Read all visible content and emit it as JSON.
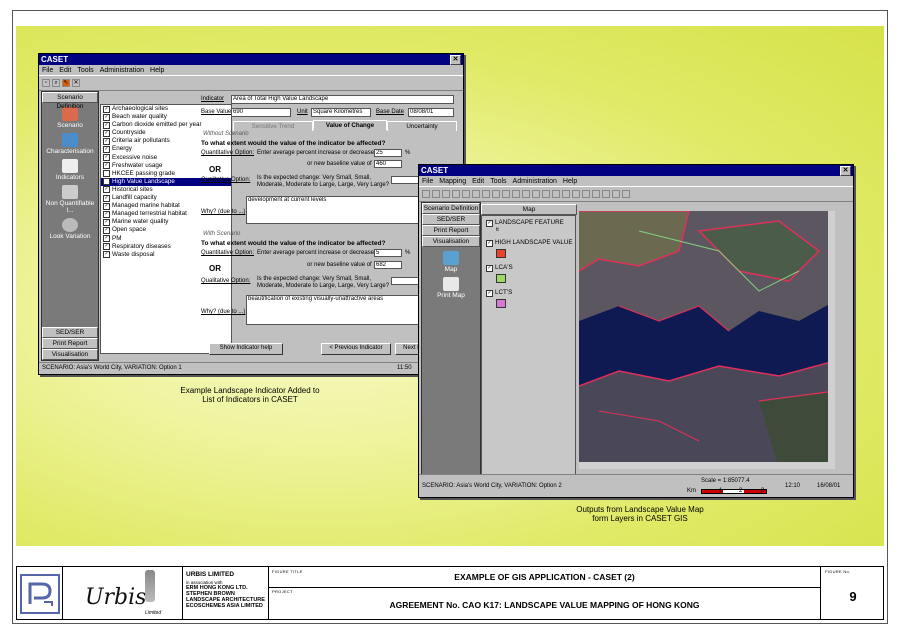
{
  "win1": {
    "title": "CASET",
    "close": "✕",
    "menu": [
      "File",
      "Edit",
      "Tools",
      "Administration",
      "Help"
    ],
    "nav_top": "Scenario Definition",
    "nav_items": [
      "Scenario",
      "Characterisation",
      "Indicators",
      "Non Quantifiable I...",
      "Look Variation"
    ],
    "nav_bottom": [
      "SED/SER",
      "Print Report",
      "Visualisation"
    ],
    "list_items": [
      {
        "label": "Archaeological sites",
        "checked": true
      },
      {
        "label": "Beach water quality",
        "checked": true
      },
      {
        "label": "Carbon dioxide emitted per year",
        "checked": true
      },
      {
        "label": "Countryside",
        "checked": true
      },
      {
        "label": "Criteria air pollutants",
        "checked": true
      },
      {
        "label": "Energy",
        "checked": true
      },
      {
        "label": "Excessive noise",
        "checked": true
      },
      {
        "label": "Freshwater usage",
        "checked": true
      },
      {
        "label": "HKCEE passing grade",
        "checked": false
      },
      {
        "label": "High Value Landscape",
        "checked": false,
        "selected": true
      },
      {
        "label": "Historical sites",
        "checked": true
      },
      {
        "label": "Landfill capacity",
        "checked": true
      },
      {
        "label": "Managed marine habitat",
        "checked": true
      },
      {
        "label": "Managed terrestrial habitat",
        "checked": true
      },
      {
        "label": "Marine water quality",
        "checked": true
      },
      {
        "label": "Open space",
        "checked": true
      },
      {
        "label": "PM",
        "checked": true
      },
      {
        "label": "Respiratory diseases",
        "checked": true
      },
      {
        "label": "Waste disposal",
        "checked": true
      }
    ],
    "indicator_label": "Indicator",
    "indicator_value": "Area of Total High Value Landscape",
    "base_value_label": "Base Value",
    "base_value": "690",
    "unit_label": "Unit",
    "unit_value": "Square Kilometres",
    "base_date_label": "Base Date",
    "base_date": "08/08/01",
    "tabs": [
      "Sensitive Trend",
      "Value of Change",
      "Uncertainty"
    ],
    "without_scenario": "Without Scenario",
    "q1": "To what extent would the value of the indicator be affected?",
    "quant_label": "Quantitative Option:",
    "quant_text": "Enter average percent increase or decrease",
    "quant1_value": "25",
    "pct": "%",
    "or_new": "or new baseline value of",
    "baseline1_value": "460",
    "or": "OR",
    "qual_label": "Qualitative Option:",
    "qual_text": "Is the expected change: Very Small, Small, Moderate, Moderate to Large, Large, Very Large?",
    "why_label": "Why? (due to ...)",
    "why1": "development at current levels",
    "with_scenario": "With Scenario",
    "q2": "To what extent would the value of the indicator be affected?",
    "quant2_value": "5",
    "baseline2_value": "682",
    "why2": "beautification of existing visually-unattractive areas",
    "btn_help": "Show Indicator help",
    "btn_prev": "< Previous Indicator",
    "btn_next": "Next I",
    "status": "SCENARIO: Asia's World City, VARIATION: Option 1",
    "status_time": "11:50"
  },
  "caption1": [
    "Example Landscape Indicator Added to",
    "List of Indicators in CASET"
  ],
  "win2": {
    "title": "CASET",
    "close": "✕",
    "menu": [
      "File",
      "Mapping",
      "Edit",
      "Tools",
      "Administration",
      "Help"
    ],
    "nav_top": "Scenario Definition",
    "nav_tabs": [
      "SED/SER",
      "Print Report",
      "Visualisation"
    ],
    "nav_items": [
      "Map",
      "Print Map"
    ],
    "layers_header": "Map",
    "layers": [
      {
        "label": "LANDSCAPE FEATURE",
        "sub": "tt",
        "color": ""
      },
      {
        "label": "HIGH LANDSCAPE VALUE",
        "sub": "",
        "color": "#e8442c"
      },
      {
        "label": "LCA'S",
        "sub": "",
        "color": "#9fd86a"
      },
      {
        "label": "LCT'S",
        "sub": "",
        "color": "#d57ad0"
      }
    ],
    "status": "SCENARIO: Asia's World City, VARIATION: Option 2",
    "scale": "Scale = 1:85077.4",
    "scale_km": "Km",
    "scale_ticks": [
      "1",
      "2",
      "3"
    ],
    "time": "12:10",
    "date": "16/08/01"
  },
  "caption2": [
    "Outputs from Landscape Value Map",
    "form Layers in CASET GIS"
  ],
  "titleblock": {
    "company": "URBIS LIMITED",
    "assoc": "in association with",
    "partners": [
      "ERM HONG KONG LTD.",
      "STEPHEN BROWN",
      "LANDSCAPE ARCHITECTURE",
      "ECOSCHEMES ASIA LIMITED"
    ],
    "logo_text": "Urbis",
    "logo_sub": "Limited",
    "figure_title_label": "FIGURE TITLE",
    "figure_title": "EXAMPLE OF GIS APPLICATION - CASET (2)",
    "project_label": "PROJECT",
    "project": "AGREEMENT No. CAO K17:  LANDSCAPE VALUE MAPPING OF HONG KONG",
    "figure_no_label": "FIGURE No.",
    "figure_no": "9"
  },
  "colors": {
    "titlebar": "#000080",
    "highlight": "#000080",
    "poster": "#e0ea66"
  }
}
